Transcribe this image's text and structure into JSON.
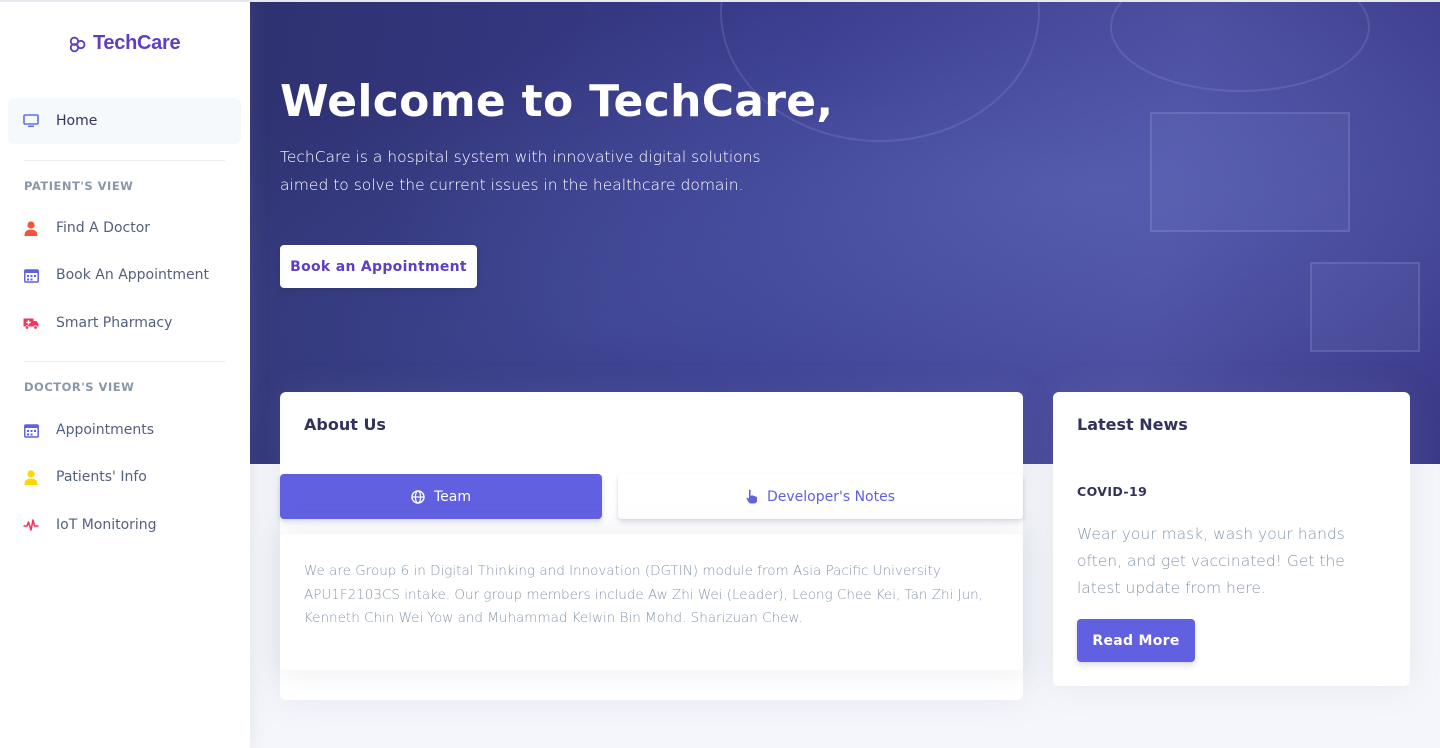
{
  "brand": {
    "name": "TechCare",
    "logo_icon": "hexagon-link-icon",
    "color": "#5e3fc4"
  },
  "sidebar": {
    "home": {
      "label": "Home",
      "icon": "monitor-icon"
    },
    "patients_heading": "PATIENT'S VIEW",
    "patient_items": [
      {
        "label": "Find A Doctor",
        "icon": "user-icon",
        "color": "#f5533d"
      },
      {
        "label": "Book An Appointment",
        "icon": "calendar-icon",
        "color": "#6160e0"
      },
      {
        "label": "Smart Pharmacy",
        "icon": "ambulance-icon",
        "color": "#f5365c"
      }
    ],
    "doctors_heading": "DOCTOR'S VIEW",
    "doctor_items": [
      {
        "label": "Appointments",
        "icon": "calendar-icon",
        "color": "#6160e0"
      },
      {
        "label": "Patients' Info",
        "icon": "user-icon",
        "color": "#ffd600"
      },
      {
        "label": "IoT Monitoring",
        "icon": "pulse-icon",
        "color": "#f5365c"
      }
    ]
  },
  "hero": {
    "title": "Welcome to TechCare,",
    "description": "TechCare is a hospital system with innovative digital solutions aimed to solve the current issues in the healthcare domain.",
    "button_label": "Book an Appointment"
  },
  "about": {
    "title": "About Us",
    "tabs": [
      {
        "label": "Team",
        "icon": "globe-icon",
        "active": true
      },
      {
        "label": "Developer's Notes",
        "icon": "hand-pointer-icon",
        "active": false
      }
    ],
    "content": "We are Group 6 in Digital Thinking and Innovation (DGTIN) module from Asia Pacific University APU1F2103CS intake. Our group members include Aw Zhi Wei (Leader), Leong Chee Kei, Tan Zhi Jun, Kenneth Chin Wei Yow and Muhammad Kelwin Bin Mohd. Sharizuan Chew."
  },
  "news": {
    "title": "Latest News",
    "tag": "COVID-19",
    "text": "Wear your mask, wash your hands often, and get vaccinated! Get the latest update from here.",
    "button_label": "Read More"
  },
  "colors": {
    "primary": "#6160e0",
    "hero_bg": "#393a8c"
  }
}
